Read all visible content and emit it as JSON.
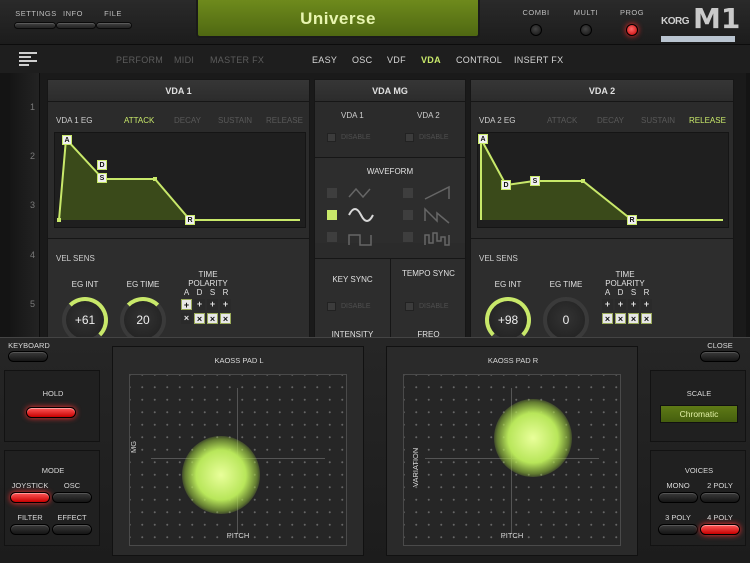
{
  "top": {
    "settings": "SETTINGS",
    "info": "INFO",
    "file": "FILE",
    "patch_name": "Universe",
    "combi": "COMBI",
    "multi": "MULTI",
    "prog": "PROG",
    "logo_brand": "KORG",
    "logo_model": "M1"
  },
  "nav": {
    "dim_tabs": [
      "PERFORM",
      "MIDI",
      "MASTER FX"
    ],
    "tabs": [
      "EASY",
      "OSC",
      "VDF",
      "VDA",
      "CONTROL",
      "INSERT FX"
    ],
    "active": "VDA"
  },
  "ruler": [
    "1",
    "2",
    "3",
    "4",
    "5"
  ],
  "vda1": {
    "title": "VDA 1",
    "eg_label": "VDA 1 EG",
    "stages": [
      "ATTACK",
      "DECAY",
      "SUSTAIN",
      "RELEASE"
    ],
    "active_stage": "ATTACK",
    "vel_sens": "VEL SENS",
    "eg_int_label": "EG INT",
    "eg_int": "+61",
    "eg_time_label": "EG TIME",
    "eg_time": "20",
    "time_polarity": "TIME POLARITY",
    "letters": [
      "A",
      "D",
      "S",
      "R"
    ]
  },
  "vda_mg": {
    "title": "VDA MG",
    "vda1": "VDA 1",
    "vda2": "VDA 2",
    "disable": "DISABLE",
    "waveform": "WAVEFORM",
    "key_sync": "KEY SYNC",
    "tempo_sync": "TEMPO SYNC",
    "intensity": "INTENSITY",
    "freq": "FREQ"
  },
  "vda2": {
    "title": "VDA 2",
    "eg_label": "VDA 2 EG",
    "stages": [
      "ATTACK",
      "DECAY",
      "SUSTAIN",
      "RELEASE"
    ],
    "active_stage": "RELEASE",
    "vel_sens": "VEL SENS",
    "eg_int_label": "EG INT",
    "eg_int": "+98",
    "eg_time_label": "EG TIME",
    "eg_time": "0",
    "time_polarity": "TIME POLARITY",
    "letters": [
      "A",
      "D",
      "S",
      "R"
    ]
  },
  "lower": {
    "keyboard": "KEYBOARD",
    "close": "CLOSE",
    "hold": "HOLD",
    "mode": "MODE",
    "joystick": "JOYSTICK",
    "osc": "OSC",
    "filter": "FILTER",
    "effect": "EFFECT",
    "pad_l": "KAOSS PAD L",
    "pad_l_y": "MG",
    "pad_l_x": "PITCH",
    "pad_r": "KAOSS PAD R",
    "pad_r_y": "VARIATION",
    "pad_r_x": "PITCH",
    "scale": "SCALE",
    "scale_value": "Chromatic",
    "voices": "VOICES",
    "mono": "MONO",
    "poly2": "2 POLY",
    "poly3": "3 POLY",
    "poly4": "4 POLY"
  },
  "colors": {
    "accent": "#c8e86a",
    "active_red": "#ff3030",
    "lcd": "#5e7a16"
  }
}
